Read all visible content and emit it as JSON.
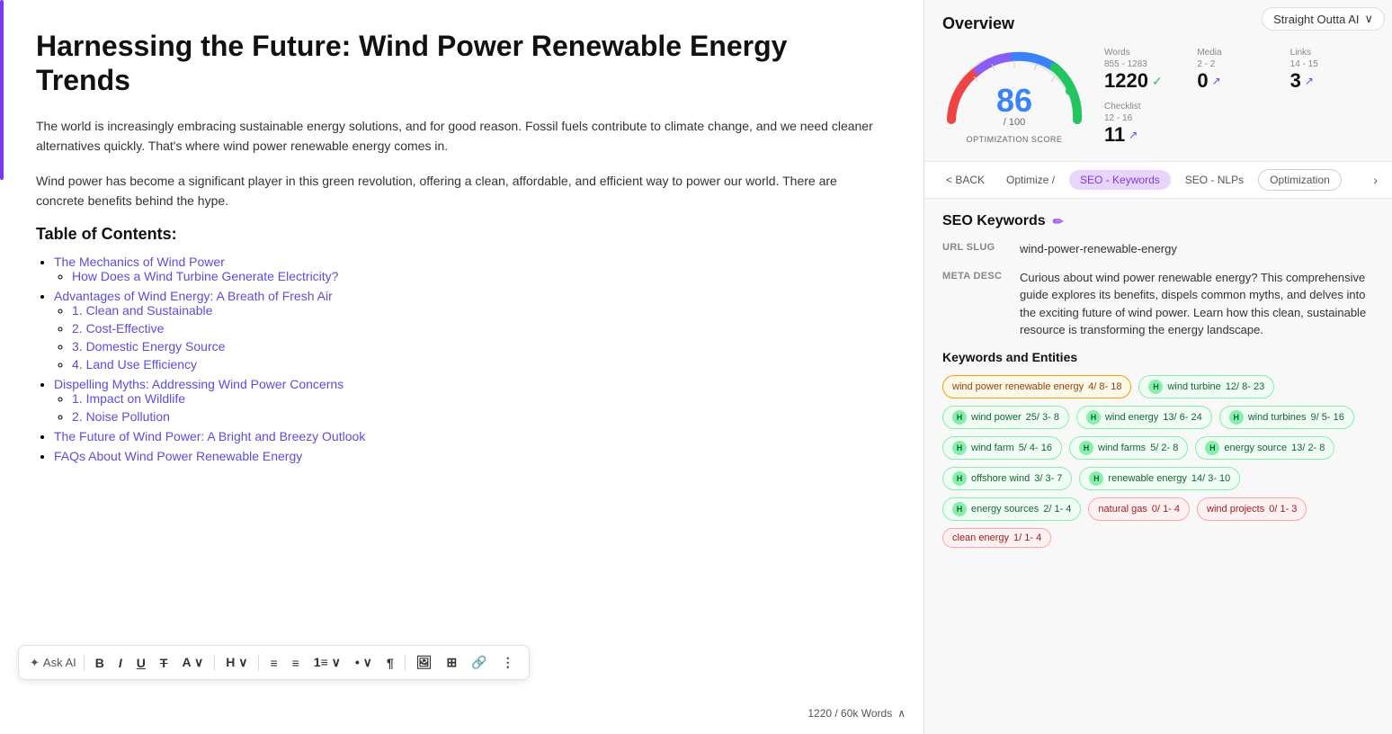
{
  "editor": {
    "title": "Harnessing the Future: Wind Power Renewable Energy Trends",
    "para1": "The world is increasingly embracing sustainable energy solutions, and for good reason. Fossil fuels contribute to climate change, and we need cleaner alternatives quickly. That's where wind power renewable energy comes in.",
    "para2": "Wind power has become a significant player in this green revolution, offering a clean, affordable, and efficient way to power our world. There are concrete benefits behind the hype.",
    "toc_heading": "Table of Contents:",
    "toc": [
      {
        "label": "The Mechanics of Wind Power",
        "sub": [
          "How Does a Wind Turbine Generate Electricity?"
        ]
      },
      {
        "label": "Advantages of Wind Energy: A Breath of Fresh Air",
        "sub": [
          "1. Clean and Sustainable",
          "2. Cost-Effective",
          "3. Domestic Energy Source",
          "4. Land Use Efficiency"
        ]
      },
      {
        "label": "Dispelling Myths: Addressing Wind Power Concerns",
        "sub": [
          "1. Impact on Wildlife",
          "2. Noise Pollution"
        ]
      },
      {
        "label": "The Future of Wind Power: A Bright and Breezy Outlook",
        "sub": []
      },
      {
        "label": "FAQs About Wind Power Renewable Energy",
        "sub": []
      }
    ],
    "word_count": "1220 / 60k Words"
  },
  "toolbar": {
    "ask_ai_label": "Ask AI",
    "bold": "B",
    "italic": "I",
    "underline": "U",
    "strikethrough": "T",
    "font_size": "A",
    "heading": "H",
    "align_left": "≡",
    "align_center": "≡",
    "list_numbered": "1.",
    "list_bullet": "•",
    "paragraph": "¶"
  },
  "panel": {
    "title": "Overview",
    "straight_outta": "Straight Outta AI",
    "score": {
      "value": 86,
      "max": 100,
      "label": "OPTIMIZATION SCORE"
    },
    "stats": [
      {
        "label": "Words",
        "range": "855 - 1283",
        "value": "1220",
        "indicator": "check"
      },
      {
        "label": "Media",
        "range": "2 - 2",
        "value": "0",
        "indicator": "arrow"
      },
      {
        "label": "Links",
        "range": "14 - 15",
        "value": "3",
        "indicator": "arrow"
      },
      {
        "label": "Checklist",
        "range": "12 - 16",
        "value": "11",
        "indicator": "arrow"
      }
    ],
    "tabs": {
      "back": "< BACK",
      "items": [
        {
          "label": "Optimize /",
          "active": true
        },
        {
          "label": "SEO - Keywords",
          "active": true
        },
        {
          "label": "SEO - NLPs",
          "active": false
        },
        {
          "label": "Optimization",
          "active": false
        }
      ]
    },
    "seo_keywords": {
      "title": "SEO Keywords",
      "url_slug_label": "URL SLUG",
      "url_slug_value": "wind-power-renewable-energy",
      "meta_desc_label": "META DESC",
      "meta_desc_value": "Curious about wind power renewable energy? This comprehensive guide explores its benefits, dispels common myths, and delves into the exciting future of wind power. Learn how this clean, sustainable resource is transforming the energy landscape.",
      "keywords_title": "Keywords and Entities",
      "keywords": [
        {
          "text": "wind power renewable energy",
          "stats": "4/ 8- 18",
          "type": "primary",
          "badge": ""
        },
        {
          "text": "wind turbine",
          "stats": "12/ 8- 23",
          "type": "green",
          "badge": "H"
        },
        {
          "text": "wind power",
          "stats": "25/ 3- 8",
          "type": "green",
          "badge": "H"
        },
        {
          "text": "wind energy",
          "stats": "13/ 6- 24",
          "type": "green",
          "badge": "H"
        },
        {
          "text": "wind turbines",
          "stats": "9/ 5- 16",
          "type": "green",
          "badge": "H"
        },
        {
          "text": "wind farm",
          "stats": "5/ 4- 16",
          "type": "green",
          "badge": "H"
        },
        {
          "text": "wind farms",
          "stats": "5/ 2- 8",
          "type": "green",
          "badge": "H"
        },
        {
          "text": "energy source",
          "stats": "13/ 2- 8",
          "type": "green",
          "badge": "H"
        },
        {
          "text": "offshore wind",
          "stats": "3/ 3- 7",
          "type": "green",
          "badge": "H"
        },
        {
          "text": "renewable energy",
          "stats": "14/ 3- 10",
          "type": "green",
          "badge": "H"
        },
        {
          "text": "energy sources",
          "stats": "2/ 1- 4",
          "type": "green",
          "badge": "H"
        },
        {
          "text": "natural gas",
          "stats": "0/ 1- 4",
          "type": "red",
          "badge": ""
        },
        {
          "text": "wind projects",
          "stats": "0/ 1- 3",
          "type": "red",
          "badge": ""
        },
        {
          "text": "clean energy",
          "stats": "1/ 1- 4",
          "type": "red",
          "badge": ""
        }
      ]
    }
  }
}
